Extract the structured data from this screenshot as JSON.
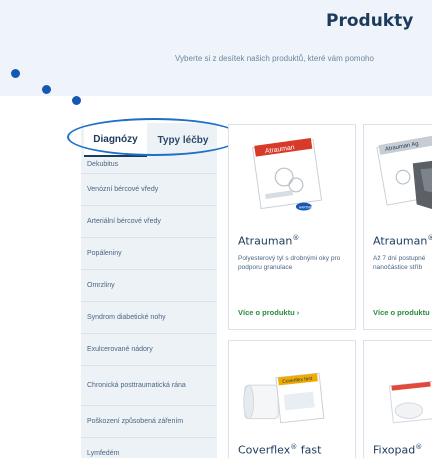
{
  "header": {
    "title": "Produkty",
    "subtitle": "Vyberte si z desítek našich produktů, které vám pomoho"
  },
  "sidebar": {
    "tabs": [
      {
        "label": "Diagnózy",
        "active": true
      },
      {
        "label": "Typy léčby",
        "active": false
      }
    ],
    "items": [
      {
        "label": "Dekubitus"
      },
      {
        "label": "Venózní bércové vředy"
      },
      {
        "label": "Arteriální bércové vředy"
      },
      {
        "label": "Popáleniny"
      },
      {
        "label": "Omrzliny"
      },
      {
        "label": "Syndrom diabetické nohy"
      },
      {
        "label": "Exulcerované nádory"
      },
      {
        "label": "Chronická posttraumatická rána"
      },
      {
        "label": "Poškození způsobená zářením"
      },
      {
        "label": "Lymfedém"
      }
    ]
  },
  "products": [
    {
      "name": "Atrauman",
      "reg": "®",
      "package_label": "Atrauman",
      "brand": "HARTMANN",
      "description": "Polyesterový tyl s drobnými oky pro podporu granulace",
      "more": "Více o produktu"
    },
    {
      "name": "Atrauman",
      "reg": "® A",
      "package_label": "Atrauman Ag",
      "description_lines": [
        "Až 7 dní postupné",
        "nanočástice stříb"
      ],
      "more": "Více o produktu"
    },
    {
      "name": "Coverflex",
      "reg": "®",
      "name_suffix": " fast",
      "package_label": "Coverflex fast"
    },
    {
      "name": "Fixopad",
      "reg": "®"
    }
  ],
  "colors": {
    "band": "#eef4f9",
    "navy": "#1b3a5c",
    "accent": "#1e6fc7",
    "link": "#2b8a3e"
  },
  "icons": {
    "more_arrow": "chevron-right-icon"
  }
}
